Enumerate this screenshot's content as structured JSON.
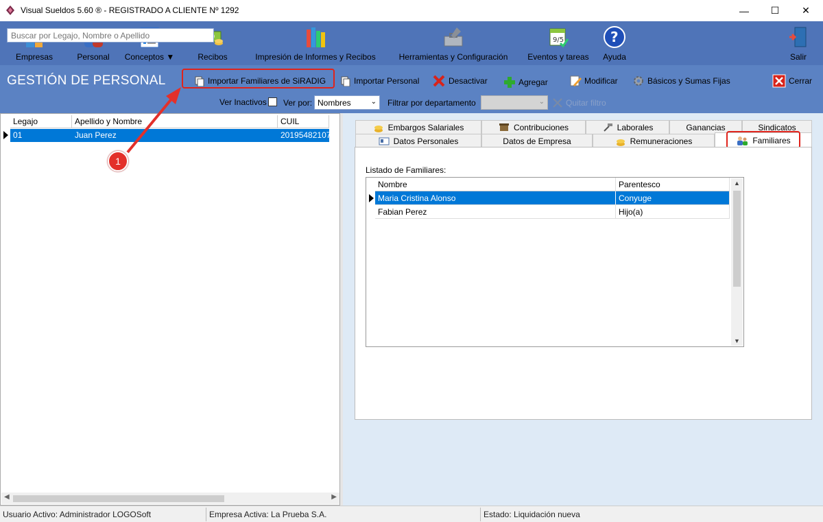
{
  "window": {
    "title": "Visual Sueldos 5.60 ®    - REGISTRADO A CLIENTE Nº 1292",
    "minimize": "—",
    "maximize": "☐",
    "close": "✕"
  },
  "toolbar": {
    "items": [
      {
        "label": "Empresas",
        "icon": "buildings-icon"
      },
      {
        "label": "Personal",
        "icon": "people-icon"
      },
      {
        "label": "Conceptos",
        "icon": "list-icon"
      },
      {
        "label": "Recibos",
        "icon": "money-icon"
      },
      {
        "label": "Impresión de Informes y Recibos",
        "icon": "books-icon"
      },
      {
        "label": "Herramientas y Configuración",
        "icon": "tools-icon"
      },
      {
        "label": "Eventos y tareas",
        "icon": "calendar-icon"
      },
      {
        "label": "Ayuda",
        "icon": "help-icon"
      },
      {
        "label": "Salir",
        "icon": "exit-door-icon"
      }
    ],
    "conceptos_dropdown": "▼"
  },
  "header": {
    "title": "GESTIÓN DE PERSONAL",
    "actions": {
      "import_family": "Importar Familiares de SiRADIG",
      "import_personal": "Importar Personal",
      "deactivate": "Desactivar",
      "add": "Agregar",
      "modify": "Modificar",
      "basics": "Básicos y Sumas Fijas",
      "close": "Cerrar"
    },
    "search_placeholder": "Buscar por Legajo, Nombre o Apellido",
    "ver_inactivos": "Ver Inactivos",
    "ver_por_label": "Ver por:",
    "ver_por_value": "Nombres",
    "filter_label": "Filtrar por departamento",
    "filter_value": "",
    "quitar_filtro": "Quitar filtro"
  },
  "employees": {
    "columns": [
      "Legajo",
      "Apellido y Nombre",
      "CUIL"
    ],
    "rows": [
      {
        "legajo": "01",
        "nombre": "Juan Perez",
        "cuil": "20195482107"
      }
    ]
  },
  "tabs": {
    "row1": [
      "Embargos Salariales",
      "Contribuciones",
      "Laborales",
      "Ganancias",
      "Sindicatos"
    ],
    "row2": [
      "Datos Personales",
      "Datos de Empresa",
      "Remuneraciones",
      "Familiares"
    ],
    "active": "Familiares"
  },
  "familiares": {
    "label": "Listado de Familiares:",
    "columns": [
      "Nombre",
      "Parentesco"
    ],
    "rows": [
      {
        "nombre": "Maria Cristina Alonso",
        "parentesco": "Conyuge"
      },
      {
        "nombre": "Fabian Perez",
        "parentesco": "Hijo(a)"
      }
    ]
  },
  "status": {
    "usuario": "Usuario Activo: Administrador LOGOSoft",
    "empresa": "Empresa Activa: La Prueba S.A.",
    "estado": "Estado: Liquidación nueva"
  },
  "annotation": {
    "step": "1"
  },
  "colors": {
    "toolbar_bg": "#4f74b8",
    "header_bg": "#5b82c3",
    "selection": "#0078d7",
    "highlight": "#e0231b"
  }
}
